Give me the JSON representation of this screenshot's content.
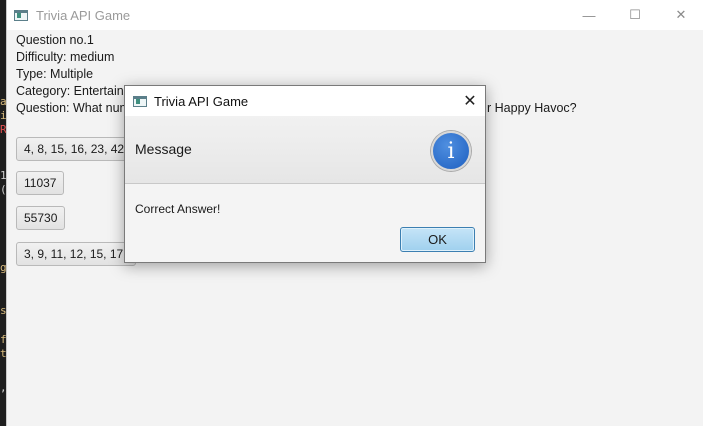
{
  "window": {
    "title": "Trivia API Game",
    "minimize": "—",
    "maximize": "☐",
    "close": "✕"
  },
  "question": {
    "number": "Question no.1",
    "difficulty": "Difficulty: medium",
    "type": "Type: Multiple",
    "category": " Category: Entertainn",
    "text_start": " Question: What num",
    "text_end": "r Happy Havoc?"
  },
  "answers": [
    "4, 8, 15, 16, 23, 42",
    "11037",
    "55730",
    "3, 9, 11, 12, 15, 17, "
  ],
  "dialog": {
    "title": "Trivia API Game",
    "close": "✕",
    "header": "Message",
    "info_glyph": "i",
    "message": "Correct Answer!",
    "ok_label": "OK"
  },
  "colors": {
    "accent_button": "#9fd0ee",
    "info_icon": "#2a6bcf",
    "terminal_bg": "#1e1e1e"
  }
}
